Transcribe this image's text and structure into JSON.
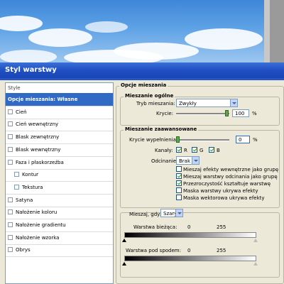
{
  "window": {
    "title": "Styl warstwy"
  },
  "style_list": {
    "header": "Style",
    "items": [
      {
        "label": "Opcje mieszania: Własne",
        "selected": true,
        "checkbox": false,
        "indent": false
      },
      {
        "label": "Cień",
        "checkbox": true,
        "indent": false
      },
      {
        "label": "Cień wewnętrzny",
        "checkbox": true,
        "indent": false
      },
      {
        "label": "Blask zewnętrzny",
        "checkbox": true,
        "indent": false
      },
      {
        "label": "Blask wewnętrzny",
        "checkbox": true,
        "indent": false
      },
      {
        "label": "Faza i płaskorzeźba",
        "checkbox": true,
        "indent": false
      },
      {
        "label": "Kontur",
        "checkbox": true,
        "indent": true
      },
      {
        "label": "Tekstura",
        "checkbox": true,
        "indent": true
      },
      {
        "label": "Satyna",
        "checkbox": true,
        "indent": false
      },
      {
        "label": "Nałożenie koloru",
        "checkbox": true,
        "indent": false
      },
      {
        "label": "Nałożenie gradientu",
        "checkbox": true,
        "indent": false
      },
      {
        "label": "Nałożenie wzorka",
        "checkbox": true,
        "indent": false
      },
      {
        "label": "Obrys",
        "checkbox": true,
        "indent": false
      }
    ]
  },
  "blending": {
    "section_title": "Opcje mieszania",
    "general": {
      "title": "Mieszanie ogólne",
      "mode_label": "Tryb mieszania:",
      "mode_value": "Zwykły",
      "opacity_label": "Krycie:",
      "opacity_value": "100",
      "opacity_unit": "%"
    },
    "advanced": {
      "title": "Mieszanie zaawansowane",
      "fill_label": "Krycie wypełnienia:",
      "fill_value": "0",
      "fill_unit": "%",
      "channels_label": "Kanały:",
      "channels": [
        {
          "label": "R",
          "checked": true
        },
        {
          "label": "G",
          "checked": true
        },
        {
          "label": "B",
          "checked": true
        }
      ],
      "knockout_label": "Odcinanie:",
      "knockout_value": "Brak",
      "options": [
        {
          "label": "Mieszaj efekty wewnętrzne jako grupę",
          "checked": false
        },
        {
          "label": "Mieszaj warstwy odcinania jako grupę",
          "checked": true
        },
        {
          "label": "Przezroczystość kształtuje warstwę",
          "checked": true
        },
        {
          "label": "Maska warstwy ukrywa efekty",
          "checked": false
        },
        {
          "label": "Maska wektorowa ukrywa efekty",
          "checked": false
        }
      ]
    },
    "blend_if": {
      "label": "Mieszaj, gdy:",
      "value": "Szary",
      "this_layer_label": "Warstwa bieżąca:",
      "this_layer_min": "0",
      "this_layer_max": "255",
      "underlying_label": "Warstwa pod spodem:",
      "underlying_min": "0",
      "underlying_max": "255"
    }
  }
}
